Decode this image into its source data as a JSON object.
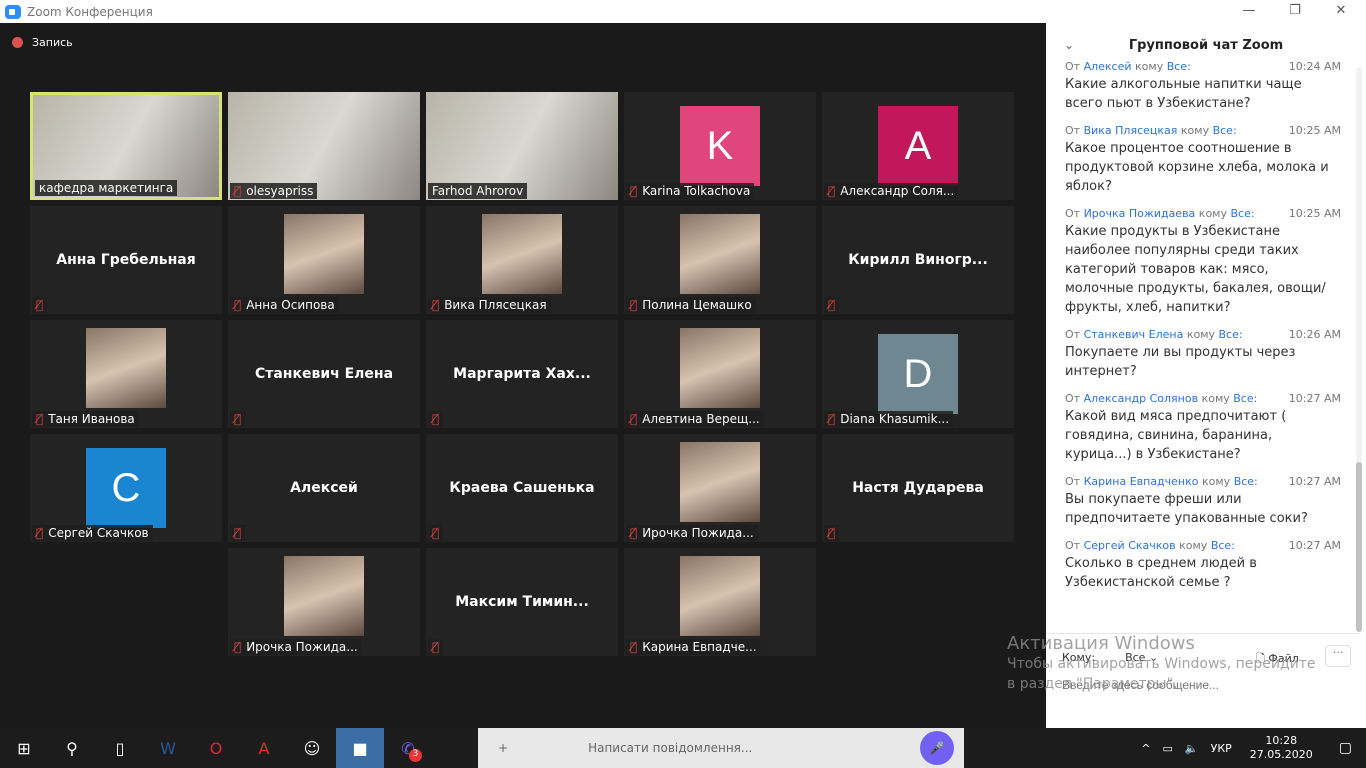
{
  "window": {
    "title": "Zoom Конференция",
    "minimize": "—",
    "restore": "❐",
    "close": "✕"
  },
  "recording": {
    "label": "Запись"
  },
  "tiles": [
    {
      "name": "кафедра маркетинга",
      "type": "video",
      "active": true,
      "muted": false
    },
    {
      "name": "olesyapriss",
      "type": "video",
      "muted": true
    },
    {
      "name": "Farhod Ahrorov",
      "type": "video",
      "muted": false
    },
    {
      "name": "Karina Tolkachova",
      "type": "avatar",
      "letter": "K",
      "color": "#e0457b",
      "muted": true
    },
    {
      "name": "Александр Соля...",
      "type": "avatar",
      "letter": "A",
      "color": "#c2185b",
      "muted": true
    },
    {
      "name": "Анна Гребельная",
      "type": "name",
      "muted": true
    },
    {
      "name": "Анна Осипова",
      "type": "photo",
      "muted": true
    },
    {
      "name": "Вика Плясецкая",
      "type": "photo",
      "muted": true
    },
    {
      "name": "Полина Цемашко",
      "type": "photo",
      "muted": true
    },
    {
      "name": "Кирилл  Виногр...",
      "type": "name",
      "muted": true
    },
    {
      "name": "Таня Иванова",
      "type": "photo",
      "muted": true
    },
    {
      "name": "Станкевич Елена",
      "type": "name",
      "muted": true
    },
    {
      "name": "Маргарита  Хах...",
      "type": "name",
      "muted": true
    },
    {
      "name": "Алевтина Верещ...",
      "type": "photo",
      "muted": true
    },
    {
      "name": "Diana Khasumik...",
      "type": "avatar",
      "letter": "D",
      "color": "#6f8790",
      "muted": true
    },
    {
      "name": "Сергей Скачков",
      "type": "avatar",
      "letter": "C",
      "color": "#1a85d0",
      "muted": true
    },
    {
      "name": "Алексей",
      "type": "name",
      "muted": true
    },
    {
      "name": "Краева Сашенька",
      "type": "name",
      "muted": true
    },
    {
      "name": "Ирочка Пожида...",
      "type": "photo",
      "muted": true
    },
    {
      "name": "Настя Дударева",
      "type": "name",
      "muted": true
    },
    {
      "name": "Ирочка Пожида...",
      "type": "photo",
      "muted": true
    },
    {
      "name": "Максим  Тимин...",
      "type": "name",
      "muted": true
    },
    {
      "name": "Карина Евпадче...",
      "type": "photo",
      "muted": true
    }
  ],
  "chat": {
    "title": "Групповой чат Zoom",
    "from": "От",
    "to": "кому",
    "all": "Все:",
    "messages": [
      {
        "sender": "Алексей",
        "time": "10:24 AM",
        "text": "Какие алкогольные напитки чаще всего пьют в Узбекистане?"
      },
      {
        "sender": "Вика Плясецкая",
        "time": "10:25 AM",
        "text": "Какое процентое соотношение в продуктовой корзине хлеба, молока и яблок?"
      },
      {
        "sender": "Ирочка Пожидаева",
        "time": "10:25 AM",
        "text": "Какие продукты в Узбекистане наиболее популярны среди таких категорий товаров как: мясо, молочные продукты, бакалея, овощи/фрукты, хлеб, напитки?"
      },
      {
        "sender": "Станкевич Елена",
        "time": "10:26 AM",
        "text": "Покупаете ли вы продукты через интернет?"
      },
      {
        "sender": "Александр Солянов",
        "time": "10:27 AM",
        "text": "Какой вид мяса предпочитают ( говядина, свинина, баранина, курица...) в Узбекистане?"
      },
      {
        "sender": "Карина Евпадченко",
        "time": "10:27 AM",
        "text": "Вы покупаете фреши или предпочитаете упакованные соки?"
      },
      {
        "sender": "Сергей Скачков",
        "time": "10:27 AM",
        "text": "Сколько в среднем людей в Узбекистанской семье ?"
      }
    ],
    "to_label": "Кому:",
    "to_value": "Все",
    "file_label": "Файл",
    "more": "···",
    "input_placeholder": "Введите здесь сообщение..."
  },
  "watermark": {
    "title": "Активация Windows",
    "text": "Чтобы активировать Windows, перейдите в раздел \"Параметры\"."
  },
  "viber": {
    "placeholder": "Написати повідомлення..."
  },
  "taskbar": {
    "viber_badge": "3",
    "lang": "УКР",
    "time": "10:28",
    "date": "27.05.2020"
  }
}
